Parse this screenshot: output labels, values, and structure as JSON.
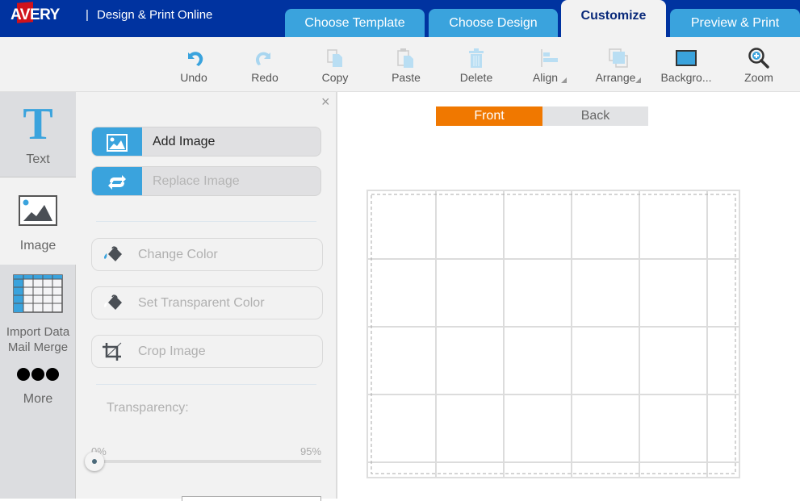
{
  "header": {
    "logo": "AVERY",
    "separator": "|",
    "app_title": "Design & Print Online",
    "tabs": [
      {
        "label": "Choose Template",
        "active": false
      },
      {
        "label": "Choose Design",
        "active": false
      },
      {
        "label": "Customize",
        "active": true
      },
      {
        "label": "Preview & Print",
        "active": false
      }
    ]
  },
  "toolbar": {
    "items": [
      {
        "label": "Undo",
        "icon": "undo-icon"
      },
      {
        "label": "Redo",
        "icon": "redo-icon"
      },
      {
        "label": "Copy",
        "icon": "copy-icon"
      },
      {
        "label": "Paste",
        "icon": "paste-icon"
      },
      {
        "label": "Delete",
        "icon": "trash-icon"
      },
      {
        "label": "Align",
        "icon": "align-icon"
      },
      {
        "label": "Arrange",
        "icon": "arrange-icon"
      },
      {
        "label": "Backgro...",
        "icon": "background-icon"
      },
      {
        "label": "Zoom",
        "icon": "zoom-icon"
      }
    ]
  },
  "leftnav": {
    "items": [
      {
        "label": "Text",
        "icon": "text-icon"
      },
      {
        "label": "Image",
        "icon": "image-icon"
      },
      {
        "label": "Import Data",
        "label2": "Mail Merge",
        "icon": "table-icon"
      },
      {
        "label": "More",
        "icon": "more-icon"
      }
    ]
  },
  "panel": {
    "close": "×",
    "add_image": "Add Image",
    "replace_image": "Replace Image",
    "change_color": "Change Color",
    "set_transparent": "Set Transparent Color",
    "crop_image": "Crop Image",
    "transparency_label": "Transparency:",
    "slider_min": "0%",
    "slider_max": "95%",
    "transparency_value_percent": 0
  },
  "canvas": {
    "front": "Front",
    "back": "Back",
    "active_side": "Front",
    "accent": "#f07800",
    "grid_columns": 6,
    "grid_rows": 5
  },
  "colors": {
    "header_bg": "#0033a0",
    "tab_bg": "#3aa3dd",
    "icon_blue": "#3aa3dd"
  }
}
